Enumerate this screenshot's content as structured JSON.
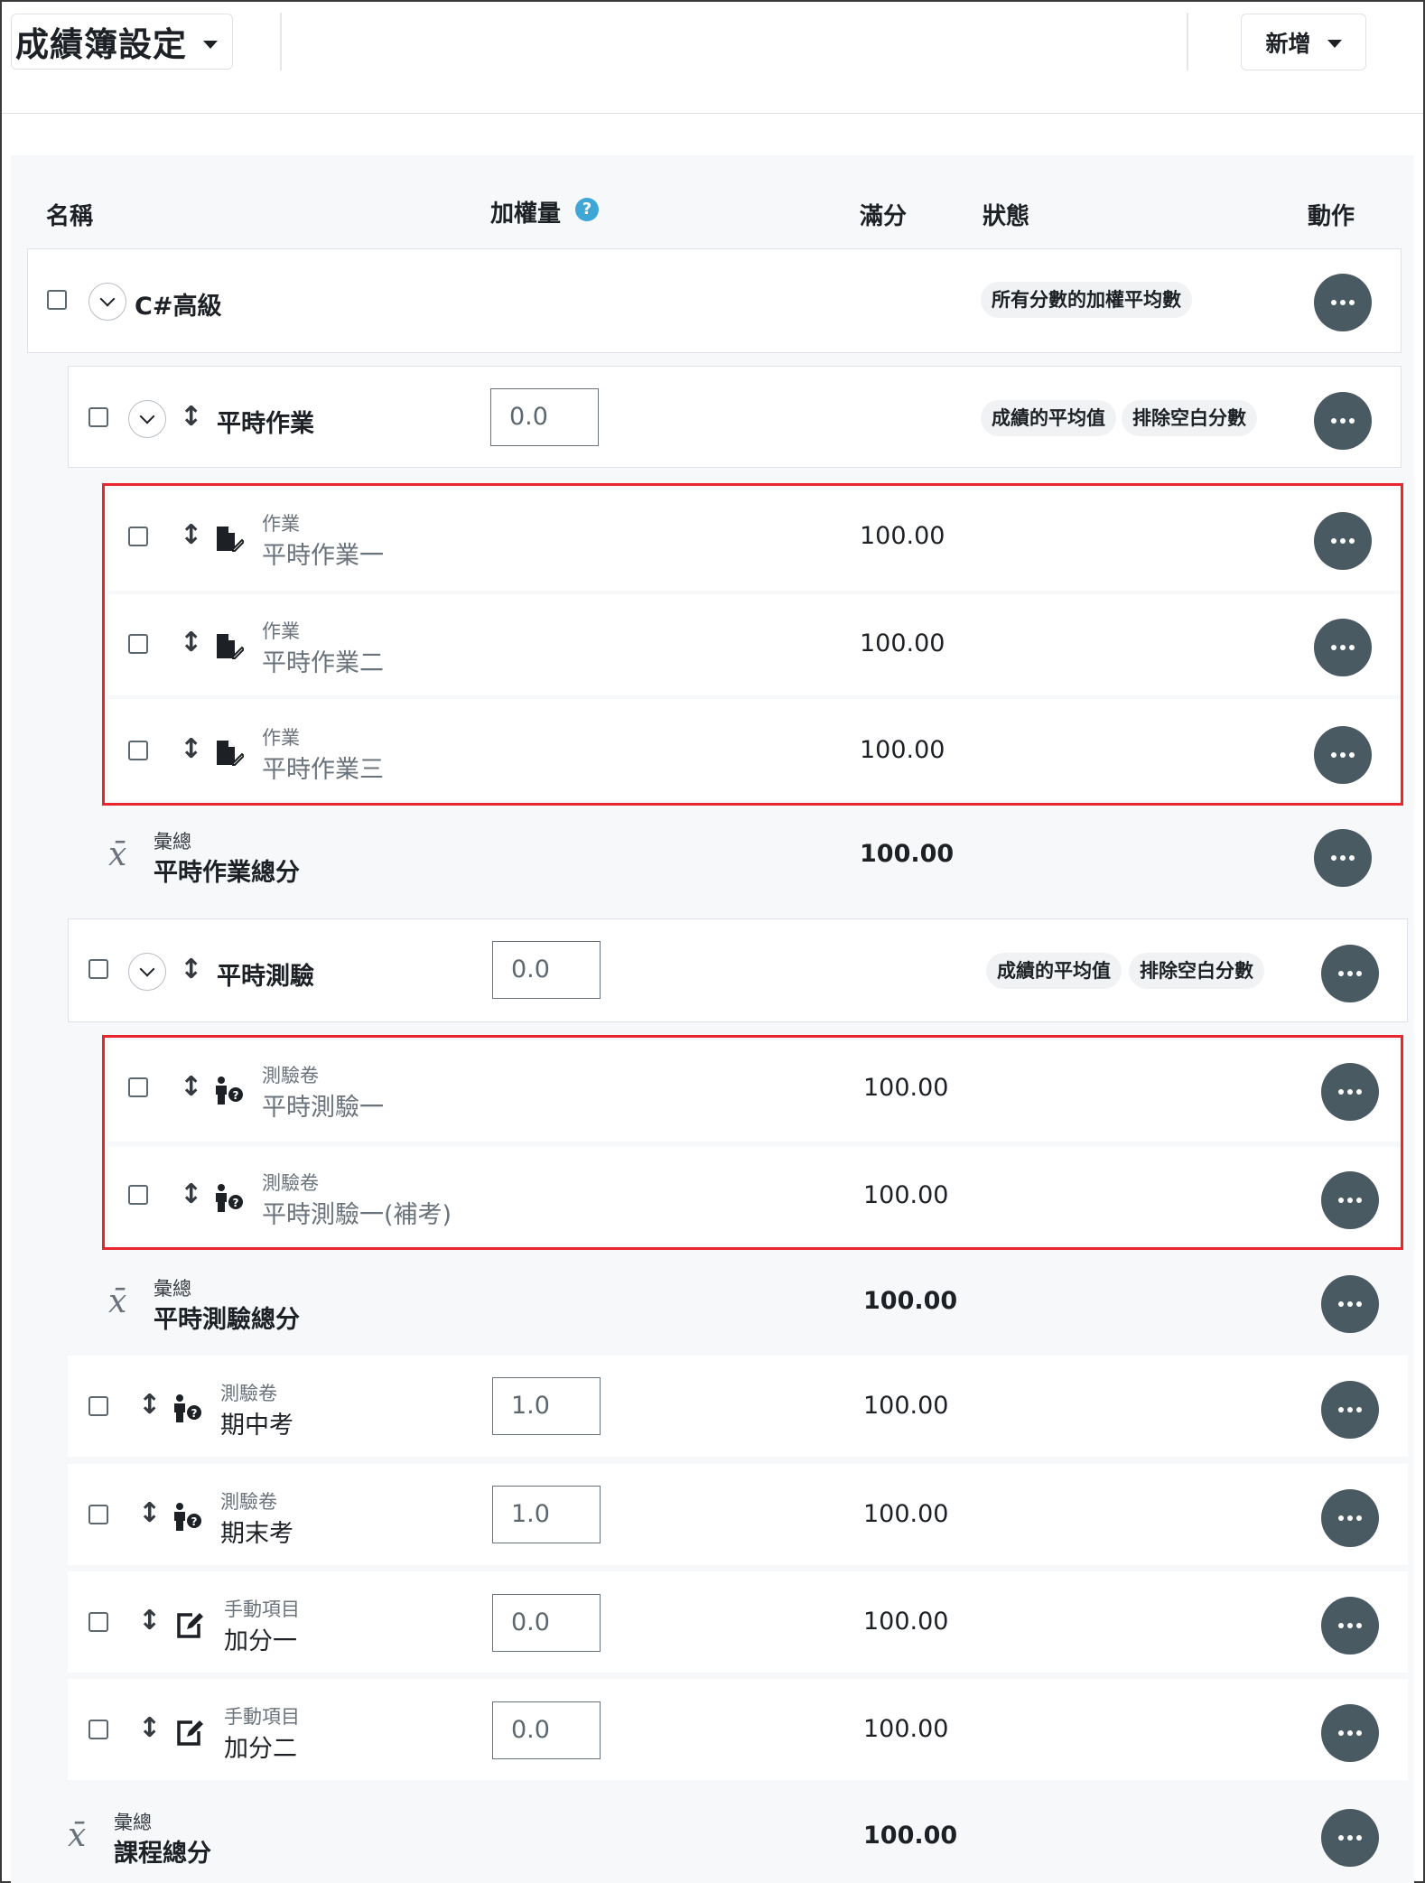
{
  "header": {
    "title": "成績簿設定",
    "new_label": "新增"
  },
  "columns": {
    "name": "名稱",
    "weight": "加權量",
    "max": "滿分",
    "status": "狀態",
    "actions": "動作"
  },
  "course": {
    "name": "C#高級",
    "status": "所有分數的加權平均數"
  },
  "cat_homework": {
    "name": "平時作業",
    "weight": "0.0",
    "badges": [
      "成績的平均值",
      "排除空白分數"
    ],
    "items": [
      {
        "type": "作業",
        "name": "平時作業一",
        "max": "100.00"
      },
      {
        "type": "作業",
        "name": "平時作業二",
        "max": "100.00"
      },
      {
        "type": "作業",
        "name": "平時作業三",
        "max": "100.00"
      }
    ],
    "total": {
      "label": "彙總",
      "name": "平時作業總分",
      "max": "100.00"
    }
  },
  "cat_quiz": {
    "name": "平時測驗",
    "weight": "0.0",
    "badges": [
      "成績的平均值",
      "排除空白分數"
    ],
    "items": [
      {
        "type": "測驗卷",
        "name": "平時測驗一",
        "max": "100.00"
      },
      {
        "type": "測驗卷",
        "name": "平時測驗一(補考)",
        "max": "100.00"
      }
    ],
    "total": {
      "label": "彙總",
      "name": "平時測驗總分",
      "max": "100.00"
    }
  },
  "items": [
    {
      "type": "測驗卷",
      "name": "期中考",
      "weight": "1.0",
      "max": "100.00",
      "icon": "quiz-icon"
    },
    {
      "type": "測驗卷",
      "name": "期末考",
      "weight": "1.0",
      "max": "100.00",
      "icon": "quiz-icon"
    },
    {
      "type": "手動項目",
      "name": "加分一",
      "weight": "0.0",
      "max": "100.00",
      "icon": "manual-item-icon"
    },
    {
      "type": "手動項目",
      "name": "加分二",
      "weight": "0.0",
      "max": "100.00",
      "icon": "manual-item-icon"
    }
  ],
  "course_total": {
    "label": "彙總",
    "name": "課程總分",
    "max": "100.00"
  },
  "colors": {
    "highlight": "#e8262f",
    "action_button": "#4a5a62",
    "help": "#3fa7d6"
  }
}
